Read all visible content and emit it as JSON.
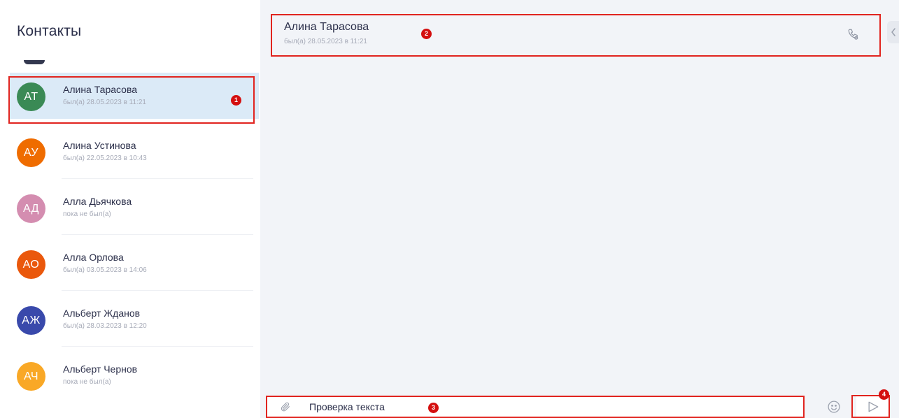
{
  "sidebar": {
    "title": "Контакты",
    "contacts": [
      {
        "initials": "АТ",
        "name": "Алина Тарасова",
        "status": "был(а) 28.05.2023 в 11:21",
        "avatar_color": "#3a8a55",
        "selected": true
      },
      {
        "initials": "АУ",
        "name": "Алина Устинова",
        "status": "был(а) 22.05.2023 в 10:43",
        "avatar_color": "#ef6c00",
        "selected": false
      },
      {
        "initials": "АД",
        "name": "Алла Дьячкова",
        "status": "пока не был(а)",
        "avatar_color": "#d48db0",
        "selected": false
      },
      {
        "initials": "АО",
        "name": "Алла Орлова",
        "status": "был(а) 03.05.2023 в 14:06",
        "avatar_color": "#ea580c",
        "selected": false
      },
      {
        "initials": "АЖ",
        "name": "Альберт Жданов",
        "status": "был(а) 28.03.2023 в 12:20",
        "avatar_color": "#3949ab",
        "selected": false
      },
      {
        "initials": "АЧ",
        "name": "Альберт Чернов",
        "status": "пока не был(а)",
        "avatar_color": "#f9a826",
        "selected": false
      }
    ]
  },
  "chat": {
    "name": "Алина Тарасова",
    "status": "был(а) 28.05.2023 в 11:21",
    "composer_value": "Проверка текста"
  },
  "annotations": {
    "marker_1": "1",
    "marker_2": "2",
    "marker_3": "3",
    "marker_4": "4",
    "color": "#e1241f"
  },
  "icons": {
    "call": "phone-icon",
    "attach": "paperclip-icon",
    "emoji": "smiley-icon",
    "send": "send-icon",
    "collapse": "chevron-left-icon"
  }
}
